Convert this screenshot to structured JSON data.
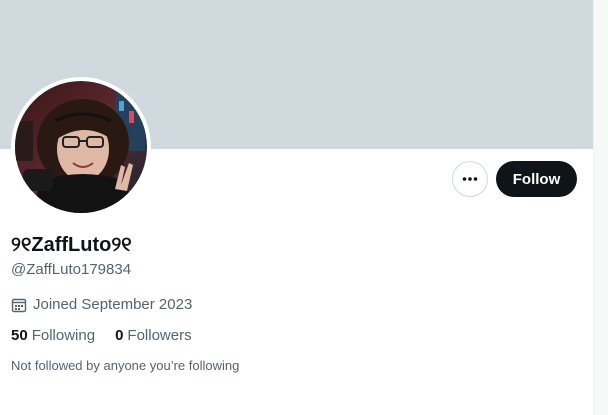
{
  "profile": {
    "display_name": "୨୧ZaffLuto୨୧",
    "handle": "@ZaffLuto179834",
    "joined": "Joined September 2023",
    "following_count": "50",
    "following_label": "Following",
    "followers_count": "0",
    "followers_label": "Followers",
    "not_followed_text": "Not followed by anyone you’re following"
  },
  "actions": {
    "more_icon": "more-horizontal-icon",
    "follow_label": "Follow"
  },
  "colors": {
    "banner": "#cfd9de",
    "primary_text": "#0f1419",
    "secondary_text": "#536471",
    "follow_button_bg": "#0f1419"
  }
}
